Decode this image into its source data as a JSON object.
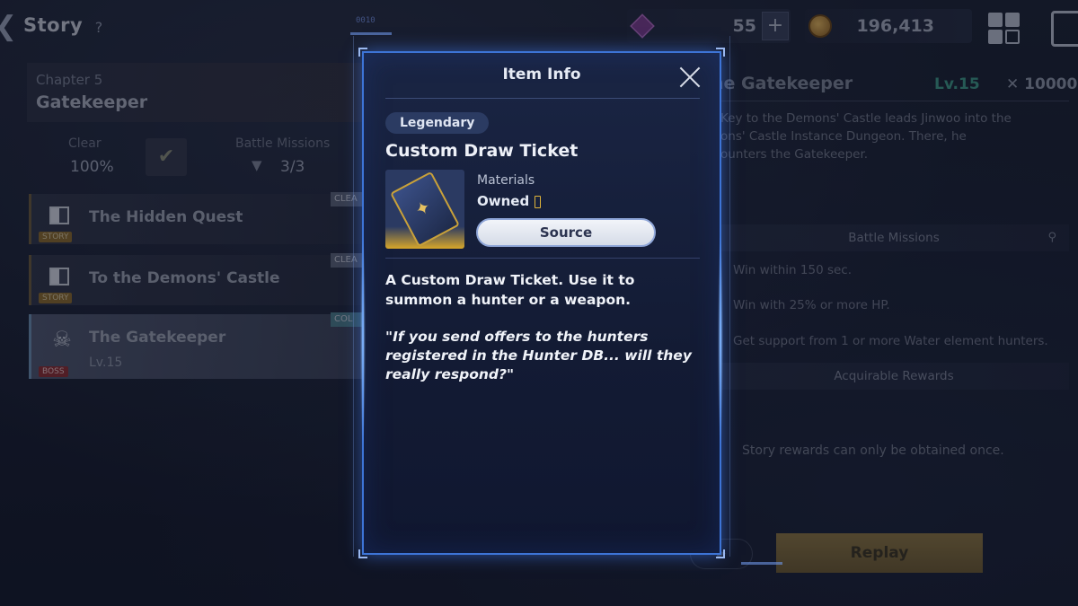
{
  "topbar": {
    "title": "Story",
    "help": "?",
    "code_tag": "0010",
    "gems": "55",
    "plus": "+",
    "gold": "196,413"
  },
  "chapter": {
    "number": "Chapter 5",
    "name": "Gatekeeper",
    "clear_label": "Clear",
    "clear_value": "100%",
    "missions_label": "Battle Missions",
    "missions_value": "3/3"
  },
  "stages": [
    {
      "title": "The Hidden Quest",
      "tag": "STORY",
      "status": "CLEA"
    },
    {
      "title": "To the Demons' Castle",
      "tag": "STORY",
      "status": "CLEA"
    },
    {
      "title": "The Gatekeeper",
      "tag": "BOSS",
      "level": "Lv.15",
      "status": "COL"
    }
  ],
  "right_panel": {
    "title": "he Gatekeeper",
    "level": "Lv.15",
    "power": "10000",
    "desc_line1": "Key to the Demons' Castle leads Jinwoo into the",
    "desc_line2": "ons' Castle Instance Dungeon. There, he",
    "desc_line3": "ounters the Gatekeeper.",
    "missions_header": "Battle Missions",
    "missions": [
      "Win within 150 sec.",
      "Win with 25% or more HP.",
      "Get support from 1 or more Water element hunters."
    ],
    "rewards_header": "Acquirable Rewards",
    "note": "Story rewards can only be obtained once.",
    "replay": "Replay"
  },
  "modal": {
    "title": "Item Info",
    "rarity": "Legendary",
    "item_name": "Custom Draw Ticket",
    "category": "Materials",
    "owned_label": "Owned",
    "source": "Source",
    "description": "A Custom Draw Ticket. Use it to summon a hunter or a weapon.",
    "quote": "\"If you send offers to the hunters registered in the Hunter DB... will they really respond?\""
  },
  "colors": {
    "modal_border": "#3d74d6",
    "legendary_gold": "#d8a72a",
    "level_green": "#3d9a86"
  }
}
